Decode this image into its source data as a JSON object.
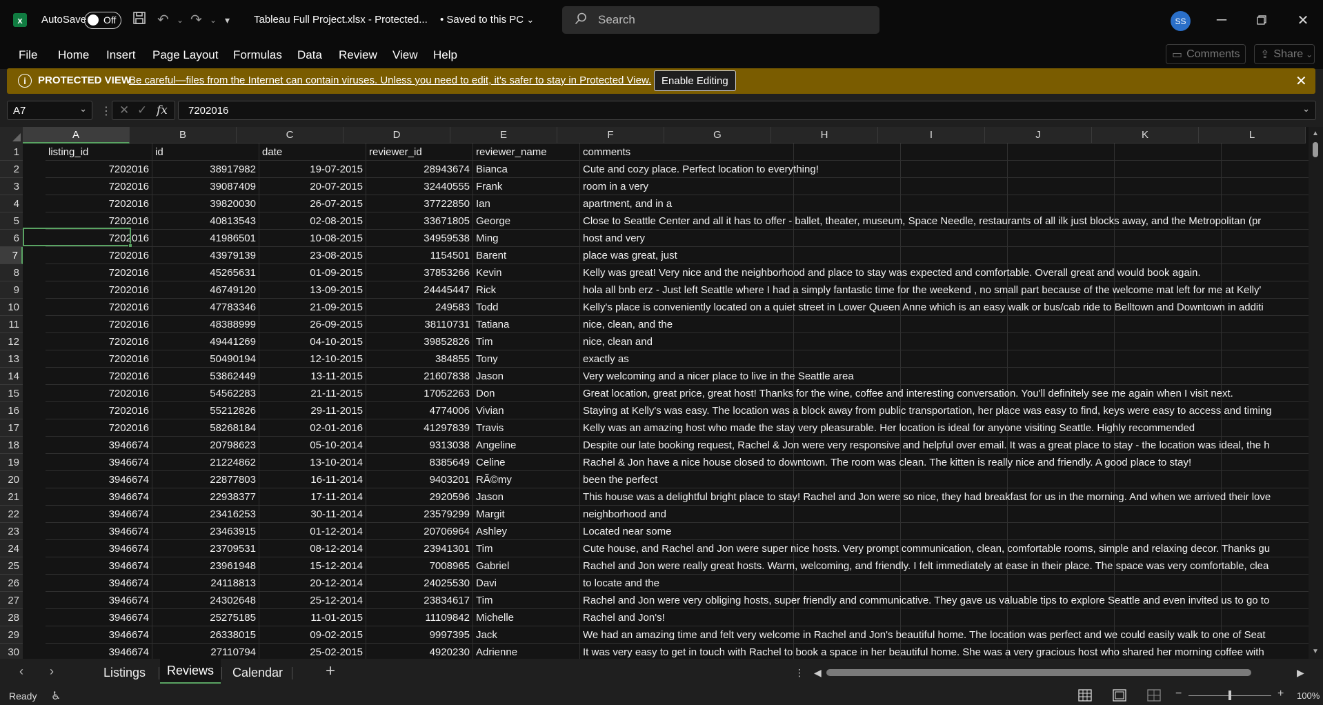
{
  "app": {
    "logo_letter": "x",
    "autosave_label": "AutoSave",
    "autosave_state": "Off",
    "file_title": "Tableau Full Project.xlsx  -  Protected...",
    "save_status": "•  Saved to this PC",
    "search_placeholder": "Search",
    "user_initials": "SS"
  },
  "ribbon": {
    "tabs": [
      "File",
      "Home",
      "Insert",
      "Page Layout",
      "Formulas",
      "Data",
      "Review",
      "View",
      "Help"
    ],
    "comments_label": "Comments",
    "share_label": "Share"
  },
  "protected_view": {
    "label": "PROTECTED VIEW",
    "message": "Be careful—files from the Internet can contain viruses. Unless you need to edit, it's safer to stay in Protected View.",
    "enable_button": "Enable Editing"
  },
  "formula_bar": {
    "name_box": "A7",
    "fx_label": "fx",
    "value": "7202016"
  },
  "columns": [
    "A",
    "B",
    "C",
    "D",
    "E",
    "F",
    "G",
    "H",
    "I",
    "J",
    "K",
    "L"
  ],
  "rows": [
    [
      "1",
      "listing_id",
      "id",
      "date",
      "reviewer_id",
      "reviewer_name",
      "comments"
    ],
    [
      "2",
      "7202016",
      "38917982",
      "19-07-2015",
      "28943674",
      "Bianca",
      "Cute and cozy place. Perfect location to everything!"
    ],
    [
      "3",
      "7202016",
      "39087409",
      "20-07-2015",
      "32440555",
      "Frank",
      "room in a very"
    ],
    [
      "4",
      "7202016",
      "39820030",
      "26-07-2015",
      "37722850",
      "Ian",
      "apartment, and in a"
    ],
    [
      "5",
      "7202016",
      "40813543",
      "02-08-2015",
      "33671805",
      "George",
      "Close to Seattle Center and all it has to offer - ballet, theater, museum, Space Needle, restaurants of all ilk just blocks away, and the Metropolitan (pr"
    ],
    [
      "6",
      "7202016",
      "41986501",
      "10-08-2015",
      "34959538",
      "Ming",
      "host and very"
    ],
    [
      "7",
      "7202016",
      "43979139",
      "23-08-2015",
      "1154501",
      "Barent",
      "place was great, just"
    ],
    [
      "8",
      "7202016",
      "45265631",
      "01-09-2015",
      "37853266",
      "Kevin",
      "Kelly was great! Very nice and the neighborhood and place to stay was expected and comfortable. Overall great and would book again."
    ],
    [
      "9",
      "7202016",
      "46749120",
      "13-09-2015",
      "24445447",
      "Rick",
      "hola all bnb erz - Just left Seattle where I had a simply fantastic time for the weekend , no small part because of the welcome mat left for me at Kelly'"
    ],
    [
      "10",
      "7202016",
      "47783346",
      "21-09-2015",
      "249583",
      "Todd",
      "Kelly's place is conveniently located on a quiet street in Lower Queen Anne which is an easy walk or bus/cab ride to Belltown and Downtown in additi"
    ],
    [
      "11",
      "7202016",
      "48388999",
      "26-09-2015",
      "38110731",
      "Tatiana",
      "nice, clean, and the"
    ],
    [
      "12",
      "7202016",
      "49441269",
      "04-10-2015",
      "39852826",
      "Tim",
      "nice, clean and"
    ],
    [
      "13",
      "7202016",
      "50490194",
      "12-10-2015",
      "384855",
      "Tony",
      "exactly as"
    ],
    [
      "14",
      "7202016",
      "53862449",
      "13-11-2015",
      "21607838",
      "Jason",
      "Very welcoming and a nicer place to live in the Seattle area"
    ],
    [
      "15",
      "7202016",
      "54562283",
      "21-11-2015",
      "17052263",
      "Don",
      "Great location, great price, great host! Thanks for the wine, coffee and interesting conversation. You'll definitely see me again when I visit next."
    ],
    [
      "16",
      "7202016",
      "55212826",
      "29-11-2015",
      "4774006",
      "Vivian",
      "Staying at Kelly's was easy. The location was a block away from public transportation, her place was easy to find, keys were easy to access and timing"
    ],
    [
      "17",
      "7202016",
      "58268184",
      "02-01-2016",
      "41297839",
      "Travis",
      "Kelly was an amazing host who made the stay very pleasurable. Her location is ideal for anyone visiting Seattle. Highly recommended"
    ],
    [
      "18",
      "3946674",
      "20798623",
      "05-10-2014",
      "9313038",
      "Angeline",
      "Despite our late booking request, Rachel & Jon were very responsive and helpful over email. It was a great place to stay - the location was ideal, the h"
    ],
    [
      "19",
      "3946674",
      "21224862",
      "13-10-2014",
      "8385649",
      "Celine",
      "Rachel & Jon have a nice house closed to downtown. The room was clean. The kitten is really nice and friendly. A good place to stay!"
    ],
    [
      "20",
      "3946674",
      "22877803",
      "16-11-2014",
      "9403201",
      "RÃ©my",
      "been the perfect"
    ],
    [
      "21",
      "3946674",
      "22938377",
      "17-11-2014",
      "2920596",
      "Jason",
      "This house was a delightful bright place to stay! Rachel and Jon were so nice, they had breakfast for us in the morning. And when we arrived their love"
    ],
    [
      "22",
      "3946674",
      "23416253",
      "30-11-2014",
      "23579299",
      "Margit",
      "neighborhood and"
    ],
    [
      "23",
      "3946674",
      "23463915",
      "01-12-2014",
      "20706964",
      "Ashley",
      "Located near some"
    ],
    [
      "24",
      "3946674",
      "23709531",
      "08-12-2014",
      "23941301",
      "Tim",
      "Cute house, and Rachel and Jon were super nice hosts.  Very prompt communication, clean, comfortable rooms, simple and relaxing decor. Thanks gu"
    ],
    [
      "25",
      "3946674",
      "23961948",
      "15-12-2014",
      "7008965",
      "Gabriel",
      "Rachel and Jon were really great hosts. Warm, welcoming, and friendly. I felt immediately at ease in their place. The space was very comfortable, clea"
    ],
    [
      "26",
      "3946674",
      "24118813",
      "20-12-2014",
      "24025530",
      "Davi",
      "to locate and the"
    ],
    [
      "27",
      "3946674",
      "24302648",
      "25-12-2014",
      "23834617",
      "Tim",
      "Rachel and Jon were very obliging hosts, super friendly and communicative. They gave us valuable tips to explore Seattle and even invited us to go to"
    ],
    [
      "28",
      "3946674",
      "25275185",
      "11-01-2015",
      "11109842",
      "Michelle",
      "Rachel and Jon's!"
    ],
    [
      "29",
      "3946674",
      "26338015",
      "09-02-2015",
      "9997395",
      "Jack",
      "We had an amazing time and felt very welcome in Rachel and Jon's beautiful home. The location was perfect and we could easily walk to one of Seat"
    ],
    [
      "30",
      "3946674",
      "27110794",
      "25-02-2015",
      "4920230",
      "Adrienne",
      "It was very easy to get in touch with Rachel to book a space in her beautiful home. She was a very gracious host who shared her morning coffee with"
    ]
  ],
  "sheets": [
    "Listings",
    "Reviews",
    "Calendar"
  ],
  "active_sheet": "Reviews",
  "status": {
    "ready": "Ready",
    "zoom": "100%"
  },
  "colors": {
    "accent_green": "#5aa463",
    "protected_bar": "#7a5c00",
    "excel_green": "#107c41"
  }
}
